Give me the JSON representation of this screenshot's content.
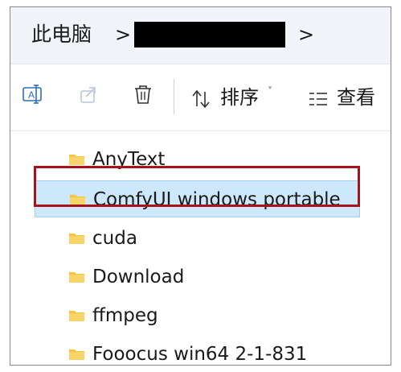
{
  "address_bar": {
    "root": "此电脑",
    "separator": ">"
  },
  "toolbar": {
    "sort_label": "排序",
    "view_label": "查看",
    "caret": "˅"
  },
  "files": [
    {
      "name": "AnyText",
      "type": "folder",
      "selected": false
    },
    {
      "name": "ComfyUI windows portable",
      "type": "folder",
      "selected": true
    },
    {
      "name": "cuda",
      "type": "folder",
      "selected": false
    },
    {
      "name": "Download",
      "type": "folder",
      "selected": false
    },
    {
      "name": "ffmpeg",
      "type": "folder",
      "selected": false
    },
    {
      "name": "Fooocus win64 2-1-831",
      "type": "folder",
      "selected": false
    }
  ],
  "colors": {
    "folder": "#f4c542",
    "selected_bg": "#cde8fb",
    "highlight_border": "#a5141b",
    "icon_blue": "#2f6db3"
  },
  "icons": {
    "rename": "rename-icon",
    "share": "share-icon",
    "delete": "trash-icon",
    "sort": "sort-arrows-icon",
    "view": "view-list-icon"
  }
}
